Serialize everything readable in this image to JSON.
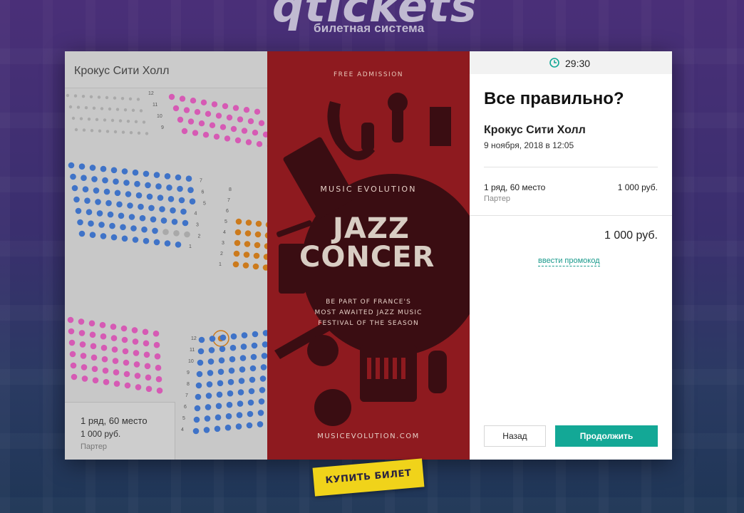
{
  "brand": {
    "logo_text": "qtickets",
    "tagline": "билетная система"
  },
  "seat_map": {
    "venue_title": "Крокус Сити Холл",
    "colors": {
      "pink": "#d65ab4",
      "blue": "#3f73c8",
      "orange": "#cc7a1c",
      "grey": "#a9a9a9"
    },
    "row_labels_top": [
      "12",
      "11",
      "10",
      "9"
    ],
    "row_labels_mid_left": [
      "7",
      "6",
      "5",
      "4",
      "3",
      "2",
      "1"
    ],
    "row_labels_mid_right": [
      "8",
      "7",
      "6",
      "5",
      "4",
      "3",
      "2",
      "1"
    ],
    "row_labels_bottom": [
      "12",
      "11",
      "10",
      "9",
      "8",
      "7",
      "6",
      "5",
      "4"
    ],
    "tooltip": {
      "seat": "1 ряд, 60 место",
      "price": "1 000 руб.",
      "sector": "Партер"
    }
  },
  "poster": {
    "free_admission": "FREE ADMISSION",
    "music_evolution": "MUSIC EVOLUTION",
    "jazz": "JAZZ",
    "concert": "CONCER",
    "tagline_1": "BE PART OF FRANCE'S",
    "tagline_2": "MOST AWAITED JAZZ MUSIC",
    "tagline_3": "FESTIVAL OF THE SEASON",
    "url": "MUSICEVOLUTION.COM"
  },
  "checkout": {
    "timer": "29:30",
    "title": "Все правильно?",
    "venue": "Крокус Сити Холл",
    "date": "9 ноября, 2018 в 12:05",
    "seat": "1 ряд, 60 место",
    "seat_price": "1 000 руб.",
    "sector": "Партер",
    "total": "1 000 руб.",
    "promo_link": "ввести промокод",
    "back_button": "Назад",
    "continue_button": "Продолжить",
    "accent_color": "#13a896"
  },
  "buy_ticket_button": "КУПИТЬ БИЛЕТ"
}
